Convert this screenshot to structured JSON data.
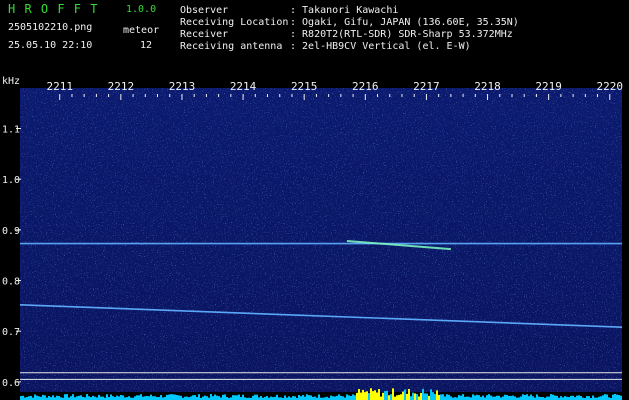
{
  "header": {
    "app_name": "H R O F F T",
    "version": "1.0.0",
    "filename": "2505102210.png",
    "datetime": "25.05.10 22:10",
    "meteor_label": "meteor",
    "meteor_count": "12",
    "info_labels": [
      "Observer",
      "Receiving Location",
      "Receiver",
      "Receiving antenna"
    ],
    "info_values": [
      ": Takanori Kawachi",
      ": Ogaki, Gifu, JAPAN (136.60E, 35.35N)",
      ": R820T2(RTL-SDR) SDR-Sharp 53.372MHz",
      ": 2el-HB9CV Vertical (el. E-W)"
    ]
  },
  "chart_data": {
    "type": "heatmap",
    "x_unit": "",
    "x_ticks": [
      "2211",
      "2212",
      "2213",
      "2214",
      "2215",
      "2216",
      "2217",
      "2218",
      "2219",
      "2220"
    ],
    "y_unit": "kHz",
    "y_ticks": [
      "1.1",
      "1.0",
      "0.9",
      "0.8",
      "0.7",
      "0.6"
    ],
    "ylim": [
      0.58,
      1.18
    ],
    "xlim": [
      2210.35,
      2220.2
    ],
    "signals": [
      {
        "kind": "horizontal-carrier",
        "y": 0.873
      },
      {
        "kind": "sloped-carrier",
        "x": [
          2210.35,
          2220.2
        ],
        "y": [
          0.752,
          0.708
        ]
      },
      {
        "kind": "meteor-echo",
        "x": [
          2215.7,
          2217.4
        ],
        "y": [
          0.878,
          0.862
        ]
      },
      {
        "kind": "reference-line",
        "y": 0.618
      },
      {
        "kind": "reference-line",
        "y": 0.605
      }
    ],
    "colors": {
      "background": "#0a1460",
      "noise": "#3a6cff",
      "carrier": "#5fb0ff",
      "echo": "#7fffc0",
      "axis_text": "#f0f0f0",
      "bar_base": "#00c8ff",
      "bar_peak": "#ffff00"
    }
  }
}
